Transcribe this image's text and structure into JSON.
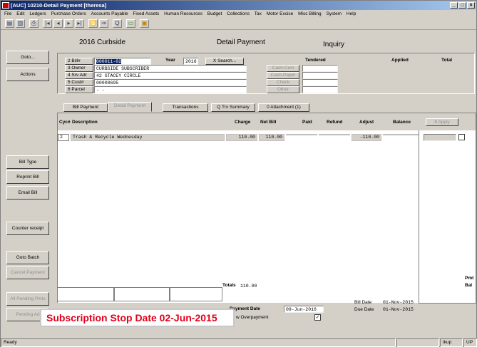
{
  "window": {
    "title": "[AUC] 10210-Detail Payment [theresa]",
    "min": "_",
    "max": "□",
    "close": "×"
  },
  "menu": [
    "File",
    "Edit",
    "Ledgers",
    "Purchase Orders",
    "Accounts Payable",
    "Fixed Assets",
    "Human Resources",
    "Budget",
    "Collections",
    "Tax",
    "Motor Excise",
    "Misc Billing",
    "System",
    "Help"
  ],
  "toolbar": {
    "icons": [
      "copy-icon",
      "paste-icon",
      "print-icon",
      "first-record-icon",
      "prev-record-icon",
      "next-record-icon",
      "last-record-icon",
      "binoculars-icon",
      "find-icon",
      "search-icon",
      "list-icon",
      "save-icon"
    ],
    "glyphs": [
      "▤",
      "▥",
      "⎙",
      "|◂",
      "◂",
      "▸",
      "▸|",
      "♋",
      "⇒",
      "Q",
      "▭",
      "▣"
    ]
  },
  "header": {
    "year_title": "2016 Curbside",
    "screen_title": "Detail Payment",
    "mode": "Inquiry"
  },
  "left_buttons": {
    "goto": "Goto...",
    "actions": "Actions",
    "bill_type": "Bill Type",
    "reprint_bill": "Reprint Bill",
    "email_bill": "Email Bill",
    "counter_receipt": "Counter receipt",
    "goto_batch": "Goto Batch",
    "cancel_payment": "Cancel Payment",
    "all_pending": "All Pending Pmts",
    "pending": "Pending Ad"
  },
  "form": {
    "bill_label": "2 Bill#",
    "bill_value": "000011-02",
    "year_label": "Year",
    "year_value": "2016",
    "search": "X Search...",
    "owner_label": "3 Owner",
    "owner_value": "CURBSIDE SUBSCRIBER",
    "srv_label": "4 Srv Adr",
    "srv_value": "42 STACEY CIRCLE",
    "cust_label": "5 Cust#",
    "cust_value": "00000695",
    "parcel_label": "6 Parcel",
    "parcel_value": "-              -"
  },
  "tender": {
    "tendered": "Tendered",
    "applied": "Applied",
    "total": "Total",
    "cash_coin": "Cash-Coin",
    "cash_paper": "Cash-Paper",
    "check": "Check",
    "other": "Other"
  },
  "tabs": {
    "bill_payment": "Bill Payment",
    "detail_payment": "Detail Payment",
    "transactions": "Transactions",
    "trx_summary": "Q Trx Summary",
    "attachment": "0 Attachment (1)"
  },
  "grid": {
    "headers": {
      "cyc": "Cyc#",
      "desc": "Description",
      "charge": "Charge",
      "net_bill": "Net Bill",
      "paid": "Paid",
      "refund": "Refund",
      "adjust": "Adjust",
      "balance": "Balance",
      "apply": "8 Apply"
    },
    "row": {
      "cyc": "2",
      "desc": "Trash & Recycle Wednesday",
      "charge": "110.00",
      "net_bill": "110.00",
      "adjust": "-110.00"
    }
  },
  "totals": {
    "label": "Totals",
    "charge": "110.00",
    "pmt": "Pmt",
    "bal": "Bal"
  },
  "payment": {
    "date_label": "Payment Date",
    "date_value": "09-Jun-2016",
    "overpayment_label": "w Overpayment",
    "checked": "☑"
  },
  "bill_info": {
    "bill_date_label": "Bill Date",
    "bill_date": "01-Nov-2015",
    "due_date_label": "Due Date",
    "due_date": "01-Nov-2015"
  },
  "banner": "Subscription Stop Date 02-Jun-2015",
  "status": {
    "ready": "Ready",
    "user": "Ikup",
    "mode": "UP"
  },
  "colors": {
    "banner_red": "#e0001a",
    "title_blue": "#0a246a",
    "highlight": "#0a246a"
  }
}
